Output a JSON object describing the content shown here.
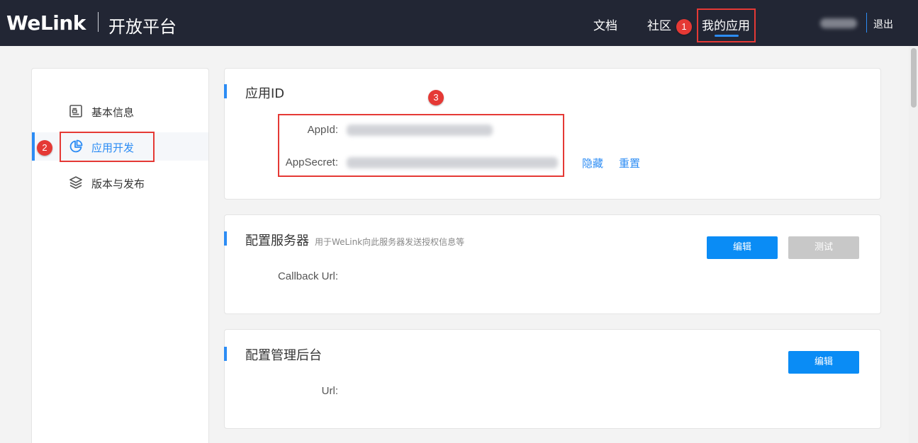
{
  "header": {
    "logo": "WeLink",
    "platform": "开放平台",
    "nav": [
      {
        "label": "文档"
      },
      {
        "label": "社区"
      },
      {
        "label": "我的应用"
      }
    ],
    "logout": "退出"
  },
  "annotations": [
    "1",
    "2",
    "3"
  ],
  "sidebar": {
    "items": [
      {
        "label": "基本信息",
        "icon": "document-icon"
      },
      {
        "label": "应用开发",
        "icon": "pie-chart-icon"
      },
      {
        "label": "版本与发布",
        "icon": "layers-icon"
      }
    ]
  },
  "app_id_card": {
    "title": "应用ID",
    "appid_label": "AppId:",
    "appsecret_label": "AppSecret:",
    "hide_link": "隐藏",
    "reset_link": "重置"
  },
  "server_card": {
    "title": "配置服务器",
    "subtitle": "用于WeLink向此服务器发送授权信息等",
    "callback_label": "Callback Url:",
    "edit_button": "编辑",
    "test_button": "测试"
  },
  "admin_card": {
    "title": "配置管理后台",
    "url_label": "Url:",
    "edit_button": "编辑"
  },
  "colors": {
    "header_bg": "#222634",
    "accent": "#2c8cf4",
    "annotation": "#e53935"
  }
}
